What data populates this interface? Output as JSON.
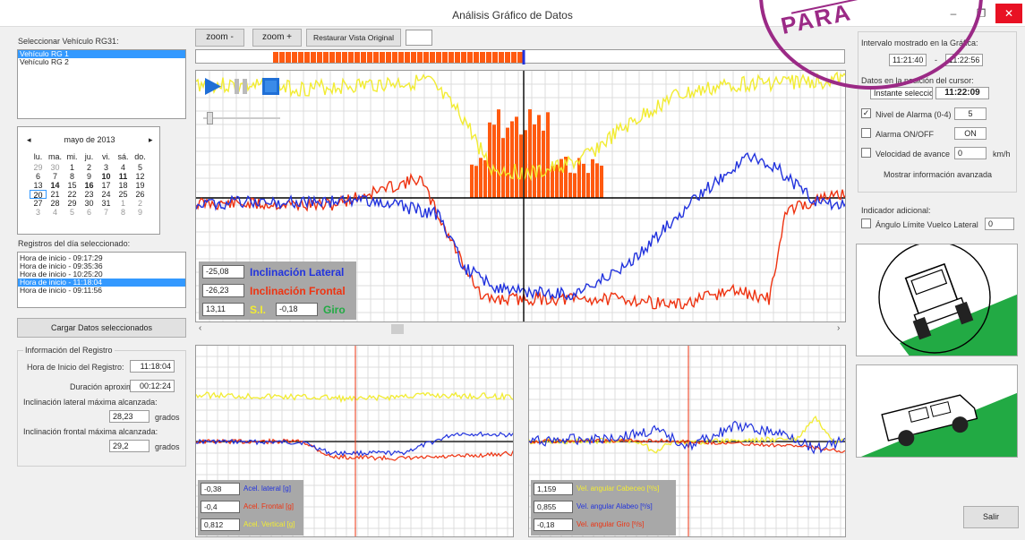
{
  "window": {
    "title": "Análisis Gráfico de Datos",
    "min": "–",
    "max": "❐",
    "close": "✕"
  },
  "left": {
    "vehicle_label": "Seleccionar Vehículo RG31:",
    "vehicles": [
      "Vehículo RG 1",
      "Vehículo RG 2"
    ],
    "calendar": {
      "month": "mayo de 2013",
      "prev": "◂",
      "next": "▸",
      "weekdays": [
        "lu.",
        "ma.",
        "mi.",
        "ju.",
        "vi.",
        "sá.",
        "do."
      ],
      "days": [
        "29",
        "30",
        "1",
        "2",
        "3",
        "4",
        "5",
        "6",
        "7",
        "8",
        "9",
        "10",
        "11",
        "12",
        "13",
        "14",
        "15",
        "16",
        "17",
        "18",
        "19",
        "20",
        "21",
        "22",
        "23",
        "24",
        "25",
        "26",
        "27",
        "28",
        "29",
        "30",
        "31",
        "1",
        "2",
        "3",
        "4",
        "5",
        "6",
        "7",
        "8",
        "9"
      ]
    },
    "records_label": "Registros del día seleccionado:",
    "records": [
      "Hora de inicio - 09:17:29",
      "Hora de inicio - 09:35:36",
      "Hora de inicio - 10:25:20",
      "Hora de inicio - 11:18:04",
      "Hora de inicio - 09:11:56"
    ],
    "load_button": "Cargar Datos seleccionados",
    "info": {
      "group_title": "Información del Registro",
      "start_label": "Hora de Inicio del Registro:",
      "start_value": "11:18:04",
      "duration_label": "Duración aproximada:",
      "duration_value": "00:12:24",
      "lat_label": "Inclinación lateral máxima alcanzada:",
      "lat_value": "28,23",
      "front_label": "Inclinación frontal máxima alcanzada:",
      "front_value": "29,2",
      "unit": "grados"
    }
  },
  "toolbar": {
    "zoom_out": "zoom -",
    "zoom_in": "zoom +",
    "restore": "Restaurar Vista Original"
  },
  "main_plot": {
    "lat_value": "-25,08",
    "lat_name": "Inclinación Lateral",
    "front_value": "-26,23",
    "front_name": "Inclinación Frontal",
    "si_value": "13,11",
    "si_name": "S.I.",
    "giro_value": "-0,18",
    "giro_name": "Giro",
    "scroll_left": "‹",
    "scroll_right": "›"
  },
  "accel_plot": {
    "v1": "-0,38",
    "n1": "Acel. lateral [g]",
    "v2": "-0,4",
    "n2": "Acel. Frontal [g]",
    "v3": "0,812",
    "n3": "Acel. Vertical [g]"
  },
  "gyro_plot": {
    "v1": "1,159",
    "n1": "Vel. angular Cabeceo [º/s]",
    "v2": "0,855",
    "n2": "Vel. angular Alabeo [º/s]",
    "v3": "-0,18",
    "n3": "Vel. angular Giro [º/s]"
  },
  "right": {
    "interval_label": "Intervalo mostrado en la Gráfica:",
    "interval_from": "11:21:40",
    "interval_sep": "-",
    "interval_to": "11:22:56",
    "cursor_label": "Datos en la posición del cursor:",
    "instant_label": "Instante seleccionado",
    "instant_value": "11:22:09",
    "alarm_level_label": "Nivel de Alarma (0-4)",
    "alarm_level_value": "5",
    "alarm_onoff_label": "Alarma ON/OFF",
    "alarm_onoff_value": "ON",
    "speed_label": "Velocidad de avance",
    "speed_value": "0",
    "speed_unit": "km/h",
    "advanced_label": "Mostrar información avanzada",
    "extra_label": "Indicador adicional:",
    "angle_label": "Ángulo Límite Vuelco Lateral",
    "angle_value": "0",
    "exit_button": "Salir",
    "stamp_text": "PARA"
  },
  "colors": {
    "blue": "#2233dd",
    "red": "#ee3311",
    "yellow": "#f2ec33",
    "orange": "#ff5a10",
    "green": "#22aa44",
    "select": "#3399ff"
  }
}
